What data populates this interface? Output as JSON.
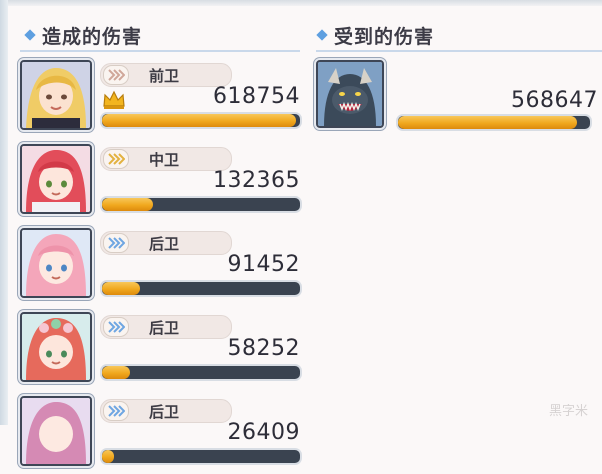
{
  "panels": {
    "dealt": {
      "title": "造成的伤害"
    },
    "received": {
      "title": "受到的伤害"
    }
  },
  "dealt_rows": [
    {
      "role": "前卫",
      "damage": "618754",
      "fill": 0.98,
      "top_crown": true,
      "portrait_icon": "blonde-character-portrait"
    },
    {
      "role": "中卫",
      "damage": "132365",
      "fill": 0.26,
      "top_crown": false,
      "portrait_icon": "red-hair-character-portrait"
    },
    {
      "role": "后卫",
      "damage": "91452",
      "fill": 0.19,
      "top_crown": false,
      "portrait_icon": "pink-hair-character-portrait"
    },
    {
      "role": "后卫",
      "damage": "58252",
      "fill": 0.14,
      "top_crown": false,
      "portrait_icon": "red-hair-flower-character-portrait"
    },
    {
      "role": "后卫",
      "damage": "26409",
      "fill": 0.06,
      "top_crown": false,
      "portrait_icon": "pink-hair-character-portrait"
    }
  ],
  "received_rows": [
    {
      "damage": "568647",
      "fill": 0.93,
      "portrait_icon": "monster-boss-portrait"
    }
  ],
  "colors": {
    "bar_fill": "#f0a81e",
    "bar_track": "#3a4350",
    "accent": "#5e9fe0"
  },
  "watermark": "黑字米"
}
